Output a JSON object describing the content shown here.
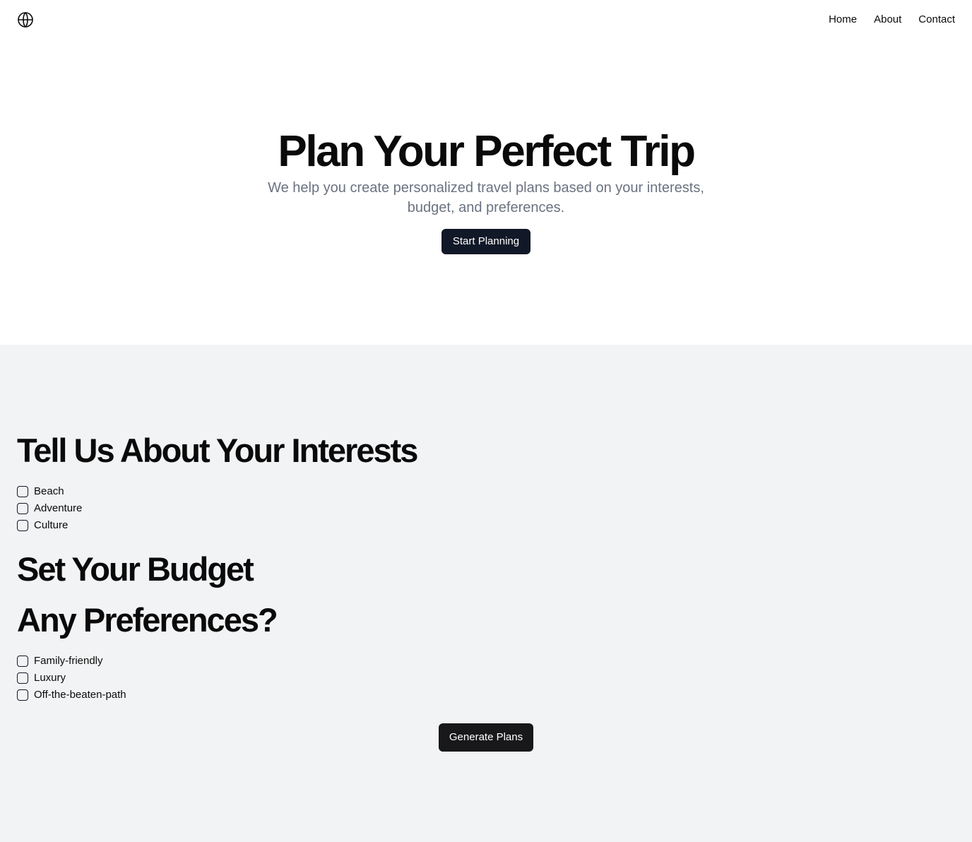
{
  "nav": {
    "logo_icon": "globe-icon",
    "links": [
      "Home",
      "About",
      "Contact"
    ]
  },
  "hero": {
    "title": "Plan Your Perfect Trip",
    "subtitle": "We help you create personalized travel plans based on your interests, budget, and preferences.",
    "cta_label": "Start Planning"
  },
  "interests": {
    "heading": "Tell Us About Your Interests",
    "options": [
      {
        "label": "Beach",
        "checked": false
      },
      {
        "label": "Adventure",
        "checked": false
      },
      {
        "label": "Culture",
        "checked": false
      }
    ]
  },
  "budget": {
    "heading": "Set Your Budget"
  },
  "preferences": {
    "heading": "Any Preferences?",
    "options": [
      {
        "label": "Family-friendly",
        "checked": false
      },
      {
        "label": "Luxury",
        "checked": false
      },
      {
        "label": "Off-the-beaten-path",
        "checked": false
      }
    ]
  },
  "submit": {
    "label": "Generate Plans"
  },
  "colors": {
    "button_dark": "#111827",
    "section_bg": "#f2f3f5",
    "subtitle_text": "#6b7280"
  }
}
